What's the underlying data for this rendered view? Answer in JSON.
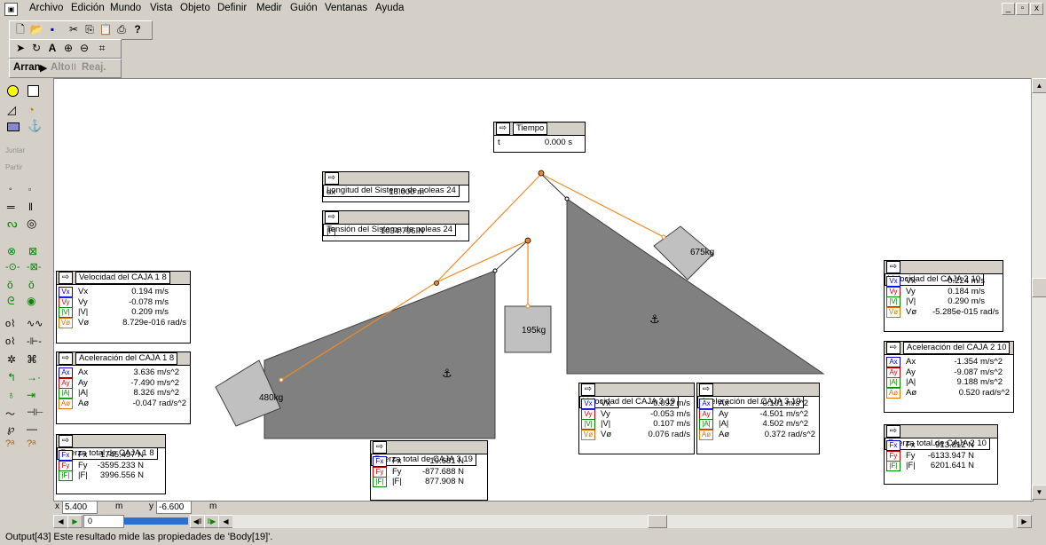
{
  "menu": [
    "Archivo",
    "Edición",
    "Mundo",
    "Vista",
    "Objeto",
    "Definir",
    "Medir",
    "Guión",
    "Ventanas",
    "Ayuda"
  ],
  "window_controls": [
    "_",
    "▫",
    "x"
  ],
  "toolbar3": {
    "run_label": "Arran",
    "stop_label": "Alto",
    "reset_label": "Reaj."
  },
  "sidetools": {
    "join_label": "Juntar",
    "split_label": "Partir"
  },
  "meters": {
    "tiempo": {
      "title": "Tiempo",
      "rows": [
        {
          "label": "t",
          "value": "0.000 s"
        }
      ]
    },
    "longitud": {
      "title": "Longitud del Sistema de poleas 24",
      "rows": [
        {
          "label": "dx",
          "value": "18.000 m"
        }
      ]
    },
    "tension": {
      "title": "Tensión del Sistema de poleas 24",
      "rows": [
        {
          "label": "|F|",
          "value": "1034.796 N"
        }
      ]
    },
    "vel1": {
      "title": "Velocidad del CAJA 1 8",
      "rows": [
        {
          "sw": "Vx",
          "label": "Vx",
          "value": "0.194 m/s"
        },
        {
          "sw": "Vy",
          "label": "Vy",
          "value": "-0.078 m/s"
        },
        {
          "sw": "|V|",
          "label": "|V|",
          "value": "0.209 m/s"
        },
        {
          "sw": "Vø",
          "label": "Vø",
          "value": "8.729e-016 rad/s"
        }
      ]
    },
    "acc1": {
      "title": "Aceleración del CAJA 1 8",
      "rows": [
        {
          "sw": "Ax",
          "label": "Ax",
          "value": "3.636 m/s^2"
        },
        {
          "sw": "Ay",
          "label": "Ay",
          "value": "-7.490 m/s^2"
        },
        {
          "sw": "|A|",
          "label": "|A|",
          "value": "8.326 m/s^2"
        },
        {
          "sw": "Aø",
          "label": "Aø",
          "value": "-0.047 rad/s^2"
        }
      ]
    },
    "force1": {
      "title": "Fuerza total de CAJA 1 8",
      "rows": [
        {
          "sw": "Fx",
          "label": "Fx",
          "value": "1745.497 N"
        },
        {
          "sw": "Fy",
          "label": "Fy",
          "value": "-3595.233 N"
        },
        {
          "sw": "|F|",
          "label": "|F|",
          "value": "3996.556 N"
        }
      ]
    },
    "force3": {
      "title": "Fuerza total de CAJA 3 19",
      "rows": [
        {
          "sw": "Fx",
          "label": "Fx",
          "value": "-19.681 N"
        },
        {
          "sw": "Fy",
          "label": "Fy",
          "value": "-877.688 N"
        },
        {
          "sw": "|F|",
          "label": "|F|",
          "value": "877.908 N"
        }
      ]
    },
    "vel3": {
      "title": "Velocidad del CAJA 3 19",
      "rows": [
        {
          "sw": "Vx",
          "label": "Vx",
          "value": "-0.092 m/s"
        },
        {
          "sw": "Vy",
          "label": "Vy",
          "value": "-0.053 m/s"
        },
        {
          "sw": "|V|",
          "label": "|V|",
          "value": "0.107 m/s"
        },
        {
          "sw": "Vø",
          "label": "Vø",
          "value": "0.076 rad/s"
        }
      ]
    },
    "acc3": {
      "title": "Aceleración del CAJA 3 19",
      "rows": [
        {
          "sw": "Ax",
          "label": "Ax",
          "value": "-0.101 m/s^2"
        },
        {
          "sw": "Ay",
          "label": "Ay",
          "value": "-4.501 m/s^2"
        },
        {
          "sw": "|A|",
          "label": "|A|",
          "value": "4.502 m/s^2"
        },
        {
          "sw": "Aø",
          "label": "Aø",
          "value": "0.372 rad/s^2"
        }
      ]
    },
    "vel2": {
      "title": "Velocidad del CAJA 2 10",
      "rows": [
        {
          "sw": "Vx",
          "label": "Vx",
          "value": "-0.224 m/s"
        },
        {
          "sw": "Vy",
          "label": "Vy",
          "value": "0.184 m/s"
        },
        {
          "sw": "|V|",
          "label": "|V|",
          "value": "0.290 m/s"
        },
        {
          "sw": "Vø",
          "label": "Vø",
          "value": "-5.285e-015 rad/s"
        }
      ]
    },
    "acc2": {
      "title": "Aceleración del CAJA 2 10",
      "rows": [
        {
          "sw": "Ax",
          "label": "Ax",
          "value": "-1.354 m/s^2"
        },
        {
          "sw": "Ay",
          "label": "Ay",
          "value": "-9.087 m/s^2"
        },
        {
          "sw": "|A|",
          "label": "|A|",
          "value": "9.188 m/s^2"
        },
        {
          "sw": "Aø",
          "label": "Aø",
          "value": "0.520 rad/s^2"
        }
      ]
    },
    "force2": {
      "title": "Fuerza total de CAJA 2 10",
      "rows": [
        {
          "sw": "Fx",
          "label": "Fx",
          "value": "-913.812 N"
        },
        {
          "sw": "Fy",
          "label": "Fy",
          "value": "-6133.947 N"
        },
        {
          "sw": "|F|",
          "label": "|F|",
          "value": "6201.641 N"
        }
      ]
    }
  },
  "bodies": {
    "box1": "480kg",
    "box2": "675kg",
    "box3": "195kg"
  },
  "coords": {
    "x_label": "x",
    "x_value": "5.400",
    "x_unit": "m",
    "y_label": "y",
    "y_value": "-6.600",
    "y_unit": "m"
  },
  "playback": {
    "frame": "0"
  },
  "status": "Output[43]  Este resultado mide las propiedades de 'Body[19]'.",
  "colors": {
    "rope": "#f08a24",
    "incline": "#808080",
    "box": "#c0c0c0",
    "canvas": "#ffffff",
    "chrome": "#d4d0c8"
  }
}
